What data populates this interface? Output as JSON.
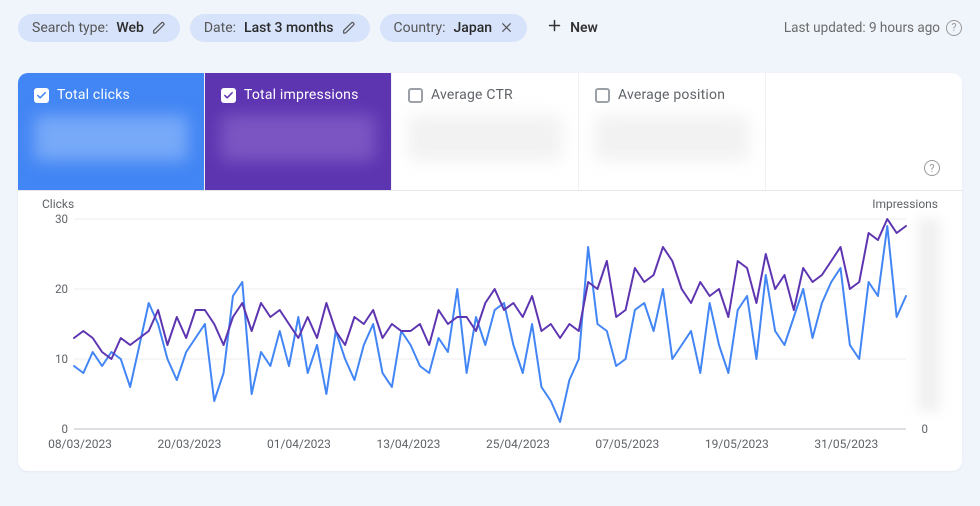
{
  "filters": {
    "search_type": {
      "prefix": "Search type:",
      "value": "Web"
    },
    "date": {
      "prefix": "Date:",
      "value": "Last 3 months"
    },
    "country": {
      "prefix": "Country:",
      "value": "Japan"
    },
    "new_label": "New"
  },
  "last_updated": "Last updated: 9 hours ago",
  "metrics": {
    "total_clicks": {
      "label": "Total clicks",
      "checked": true
    },
    "total_impressions": {
      "label": "Total impressions",
      "checked": true
    },
    "avg_ctr": {
      "label": "Average CTR",
      "checked": false
    },
    "avg_position": {
      "label": "Average position",
      "checked": false
    }
  },
  "axis": {
    "left_title": "Clicks",
    "right_title": "Impressions",
    "y_ticks": [
      "30",
      "20",
      "10",
      "0"
    ],
    "right_zero": "0",
    "x_ticks": [
      "08/03/2023",
      "20/03/2023",
      "01/04/2023",
      "13/04/2023",
      "25/04/2023",
      "07/05/2023",
      "19/05/2023",
      "31/05/2023"
    ]
  },
  "chart_data": {
    "type": "line",
    "xlabel": "",
    "title": "",
    "ylabel_left": "Clicks",
    "ylabel_right": "Impressions",
    "ylim": [
      0,
      30
    ],
    "x_tick_labels": [
      "08/03/2023",
      "20/03/2023",
      "01/04/2023",
      "13/04/2023",
      "25/04/2023",
      "07/05/2023",
      "19/05/2023",
      "31/05/2023"
    ],
    "categories_index": [
      0,
      1,
      2,
      3,
      4,
      5,
      6,
      7,
      8,
      9,
      10,
      11,
      12,
      13,
      14,
      15,
      16,
      17,
      18,
      19,
      20,
      21,
      22,
      23,
      24,
      25,
      26,
      27,
      28,
      29,
      30,
      31,
      32,
      33,
      34,
      35,
      36,
      37,
      38,
      39,
      40,
      41,
      42,
      43,
      44,
      45,
      46,
      47,
      48,
      49,
      50,
      51,
      52,
      53,
      54,
      55,
      56,
      57,
      58,
      59,
      60,
      61,
      62,
      63,
      64,
      65,
      66,
      67,
      68,
      69,
      70,
      71,
      72,
      73,
      74,
      75,
      76,
      77,
      78,
      79,
      80,
      81,
      82,
      83,
      84,
      85,
      86,
      87,
      88,
      89
    ],
    "series": [
      {
        "name": "Total clicks",
        "color": "#4285f4",
        "values": [
          9,
          8,
          11,
          9,
          11,
          10,
          6,
          12,
          18,
          15,
          10,
          7,
          11,
          13,
          15,
          4,
          8,
          19,
          21,
          5,
          11,
          9,
          14,
          9,
          16,
          8,
          12,
          5,
          14,
          10,
          7,
          12,
          15,
          8,
          6,
          14,
          12,
          9,
          8,
          13,
          11,
          20,
          8,
          16,
          12,
          17,
          18,
          12,
          8,
          15,
          6,
          4,
          1,
          7,
          10,
          26,
          15,
          14,
          9,
          10,
          17,
          18,
          14,
          20,
          10,
          12,
          14,
          8,
          18,
          12,
          8,
          17,
          19,
          10,
          22,
          14,
          12,
          16,
          20,
          13,
          18,
          21,
          23,
          12,
          10,
          21,
          19,
          29,
          16,
          19
        ]
      },
      {
        "name": "Total impressions",
        "color": "#5e35b1",
        "values": [
          13,
          14,
          13,
          11,
          10,
          13,
          12,
          13,
          14,
          17,
          12,
          16,
          13,
          17,
          17,
          15,
          12,
          16,
          18,
          14,
          18,
          16,
          17,
          15,
          13,
          16,
          13,
          18,
          14,
          12,
          16,
          15,
          17,
          13,
          15,
          14,
          14,
          15,
          12,
          17,
          15,
          16,
          16,
          14,
          18,
          20,
          17,
          18,
          16,
          19,
          14,
          15,
          13,
          15,
          14,
          21,
          20,
          24,
          16,
          17,
          23,
          21,
          22,
          26,
          24,
          20,
          18,
          21,
          19,
          20,
          16,
          24,
          23,
          18,
          25,
          20,
          22,
          17,
          23,
          21,
          22,
          24,
          26,
          20,
          21,
          28,
          27,
          30,
          28,
          29
        ]
      }
    ]
  }
}
